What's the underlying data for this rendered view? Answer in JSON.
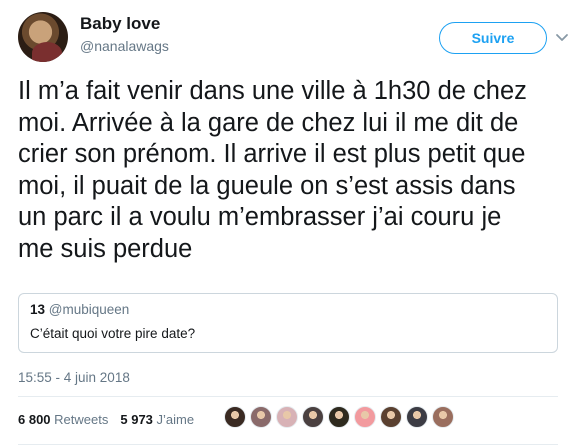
{
  "author": {
    "display_name": "Baby love",
    "handle": "@nanalawags"
  },
  "actions": {
    "follow_label": "Suivre",
    "menu_icon": "chevron-down-icon"
  },
  "tweet": {
    "text": "Il m’a fait venir dans une ville à 1h30 de chez\nmoi. Arrivée à la gare de chez lui il me dit de\ncrier son prénom. Il  arrive il est plus petit que\nmoi, il puait de la gueule on s’est assis dans\nun parc il a voulu m’embrasser j’ai couru je\nme suis perdue",
    "timestamp": "15:55 - 4 juin 2018"
  },
  "quoted_tweet": {
    "name": "13",
    "handle": "@mubiqueen",
    "text": "C’était quoi votre pire date?"
  },
  "stats": {
    "retweets_count": "6 800",
    "retweets_label": "Retweets",
    "likes_count": "5 973",
    "likes_label": "J’aime"
  },
  "likers": [
    {
      "color": "#3a2a22"
    },
    {
      "color": "#8a6a6a"
    },
    {
      "color": "#d8b2b6"
    },
    {
      "color": "#4a4040"
    },
    {
      "color": "#2e2a1e"
    },
    {
      "color": "#f29a9e"
    },
    {
      "color": "#5a4030"
    },
    {
      "color": "#3c3c44"
    },
    {
      "color": "#9a6e5e"
    }
  ]
}
